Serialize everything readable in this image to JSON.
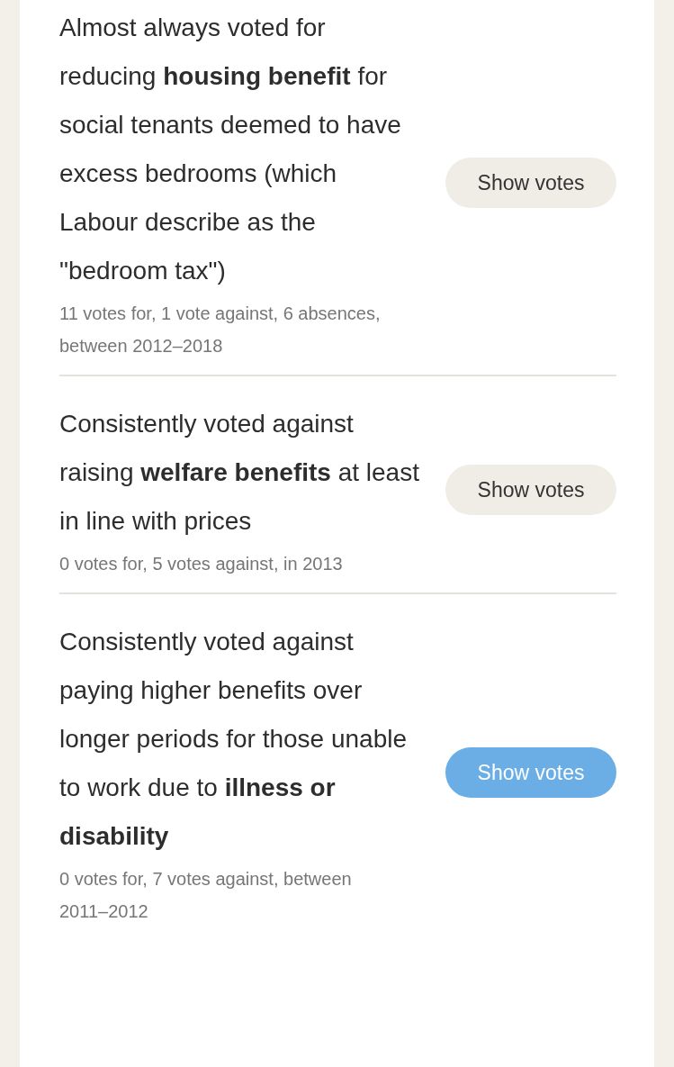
{
  "policies": [
    {
      "text": "Almost always voted for reducing **housing benefit** for social tenants deemed to have excess bedrooms (which Labour describe as the \"bedroom tax\")",
      "summary": "11 votes for, 1 vote against, 6 absences, between 2012–2018",
      "button": {
        "label": "Show votes",
        "selected": false
      }
    },
    {
      "text": "Consistently voted against raising **welfare benefits** at least in line with prices",
      "summary": "0 votes for, 5 votes against, in 2013",
      "button": {
        "label": "Show votes",
        "selected": false
      }
    },
    {
      "text": "Consistently voted against paying higher benefits over longer periods for those unable to work due to **illness or disability**",
      "summary": "0 votes for, 7 votes against, between 2011–2012",
      "button": {
        "label": "Show votes",
        "selected": true
      }
    }
  ]
}
